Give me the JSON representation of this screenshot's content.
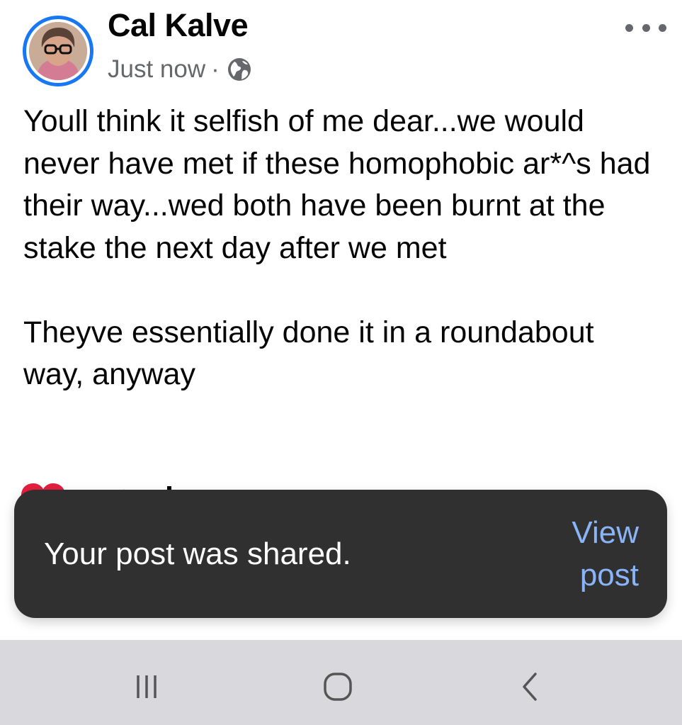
{
  "post": {
    "author": "Cal Kalve",
    "timestamp": "Just now",
    "separator": "·",
    "audience_icon": "globe-icon",
    "more_icon": "more-options-icon",
    "paragraphs": [
      "Youll think it selfish of me dear...we would never have met if these homophobic ar*^s had their way...wed both have been burnt at the stake the next day after we met",
      "Theyve essentially done it in a roundabout way, anyway"
    ],
    "reaction_icon": "heart-icon"
  },
  "toast": {
    "message": "Your post was shared.",
    "action": "View post"
  },
  "nav": {
    "recents_icon": "recent-apps-icon",
    "home_icon": "home-icon",
    "back_icon": "back-icon"
  },
  "colors": {
    "accent": "#1877f2",
    "text_primary": "#050505",
    "text_secondary": "#65676b",
    "toast_bg": "#303030",
    "toast_action": "#8ab4f8",
    "nav_bg": "#d9d9dd",
    "heart": "#e41e3f"
  }
}
